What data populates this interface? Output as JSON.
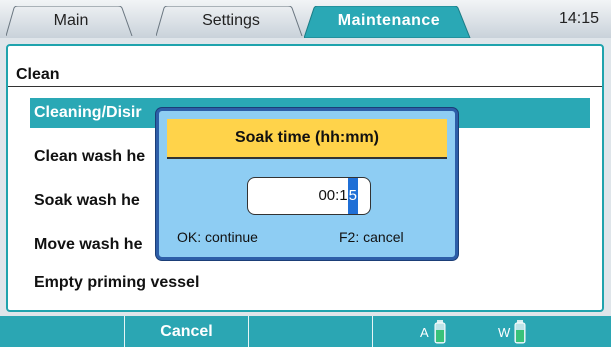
{
  "tabs": [
    {
      "label": "Main",
      "active": false
    },
    {
      "label": "Settings",
      "active": false
    },
    {
      "label": "Maintenance",
      "active": true
    }
  ],
  "clock": "14:15",
  "panel": {
    "title": "Clean",
    "items": [
      {
        "label": "Cleaning/Disir",
        "selected": true
      },
      {
        "label": "Clean wash he",
        "selected": false
      },
      {
        "label": "Soak wash he",
        "selected": false
      },
      {
        "label": "Move wash he",
        "selected": false
      },
      {
        "label": "Empty priming vessel",
        "selected": false
      }
    ]
  },
  "dialog": {
    "title": "Soak time (hh:mm)",
    "value_prefix": "00:1",
    "value_cursor": "5",
    "hint_left": "OK: continue",
    "hint_right": "F2: cancel"
  },
  "softkeys": {
    "cancel_label": "Cancel"
  },
  "bottles": [
    {
      "label": "A",
      "icon": "bottle-icon"
    },
    {
      "label": "W",
      "icon": "bottle-icon"
    }
  ],
  "colors": {
    "accent": "#2aa8b5",
    "dialog_bg": "#8ecdf3",
    "dialog_title_bg": "#ffd34a",
    "cursor": "#1f6fd6"
  }
}
